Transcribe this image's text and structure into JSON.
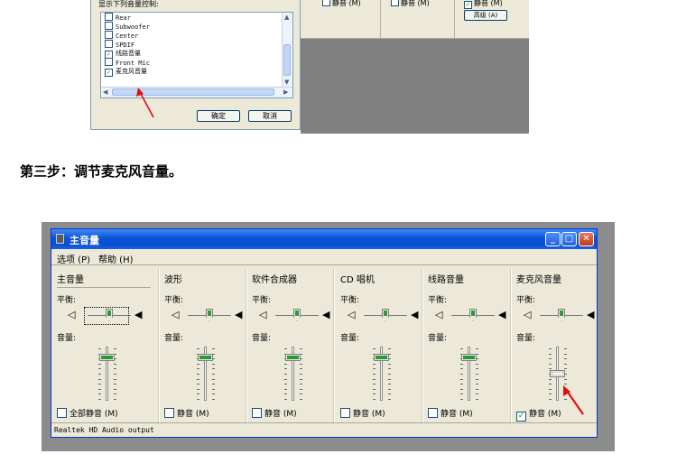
{
  "top_dialog": {
    "title": "显示下列音量控制:",
    "items": [
      {
        "label": "Rear",
        "checked": false
      },
      {
        "label": "Subwoofer",
        "checked": false
      },
      {
        "label": "Center",
        "checked": false
      },
      {
        "label": "SPDIF",
        "checked": false
      },
      {
        "label": "线路音量",
        "checked": true
      },
      {
        "label": "Front Mic",
        "checked": false
      },
      {
        "label": "麦克风音量",
        "checked": true
      }
    ],
    "ok_label": "确定",
    "cancel_label": "取消"
  },
  "top_mixer": {
    "mutes": [
      {
        "label": "静音 (M)",
        "checked": false
      },
      {
        "label": "静音 (M)",
        "checked": false
      },
      {
        "label": "静音 (M)",
        "checked": true
      }
    ],
    "advanced_label": "高级 (A)"
  },
  "step_text": "第三步：调节麦克风音量。",
  "mixer": {
    "title": "主音量",
    "menu": [
      "选项 (P)",
      "帮助 (H)"
    ],
    "balance_label": "平衡:",
    "volume_label": "音量:",
    "columns": [
      {
        "name": "主音量",
        "mute_label": "全部静音 (M)",
        "mute_checked": false,
        "volume": 0.85
      },
      {
        "name": "波形",
        "mute_label": "静音 (M)",
        "mute_checked": false,
        "volume": 0.85
      },
      {
        "name": "软件合成器",
        "mute_label": "静音 (M)",
        "mute_checked": false,
        "volume": 0.85
      },
      {
        "name": "CD 唱机",
        "mute_label": "静音 (M)",
        "mute_checked": false,
        "volume": 0.85
      },
      {
        "name": "线路音量",
        "mute_label": "静音 (M)",
        "mute_checked": false,
        "volume": 0.85
      },
      {
        "name": "麦克风音量",
        "mute_label": "静音 (M)",
        "mute_checked": true,
        "volume": 0.5
      }
    ],
    "status": "Realtek HD Audio output"
  },
  "colors": {
    "accent_arrow": "#e01010",
    "slider_green": "#2a9a3a",
    "titlebar_blue": "#0a53d6"
  }
}
